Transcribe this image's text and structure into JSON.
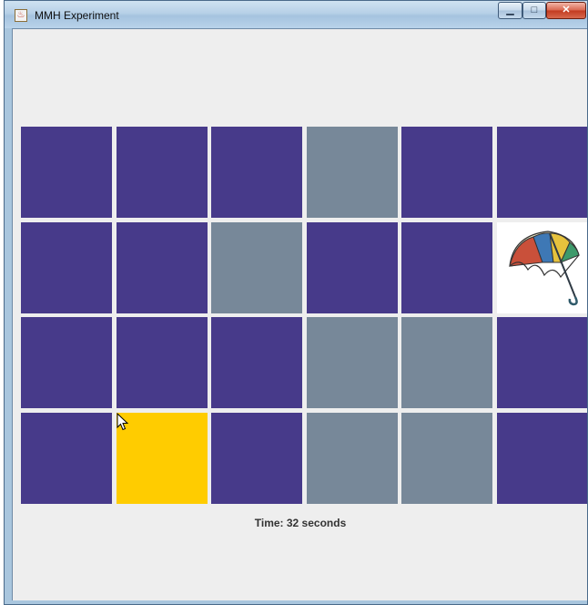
{
  "window": {
    "title": "MMH Experiment",
    "icon": "java-cup-icon",
    "controls": {
      "minimize_icon": "minimize-icon",
      "maximize_icon": "maximize-icon",
      "close_icon": "close-icon"
    }
  },
  "colors": {
    "hidden_card": "#473a8a",
    "matched_card": "#778899",
    "selected_card": "#ffcc00",
    "revealed_card": "#ffffff",
    "background": "#eeeeee"
  },
  "board": {
    "rows": 4,
    "columns": 6,
    "cards": [
      [
        "hidden",
        "hidden",
        "hidden",
        "matched",
        "hidden",
        "hidden"
      ],
      [
        "hidden",
        "hidden",
        "matched",
        "hidden",
        "hidden",
        "revealed"
      ],
      [
        "hidden",
        "hidden",
        "hidden",
        "matched",
        "matched",
        "hidden"
      ],
      [
        "hidden",
        "selected",
        "hidden",
        "matched",
        "matched",
        "hidden"
      ]
    ],
    "revealed_image": "umbrella-image"
  },
  "status": {
    "time_text": "Time: 32 seconds"
  }
}
